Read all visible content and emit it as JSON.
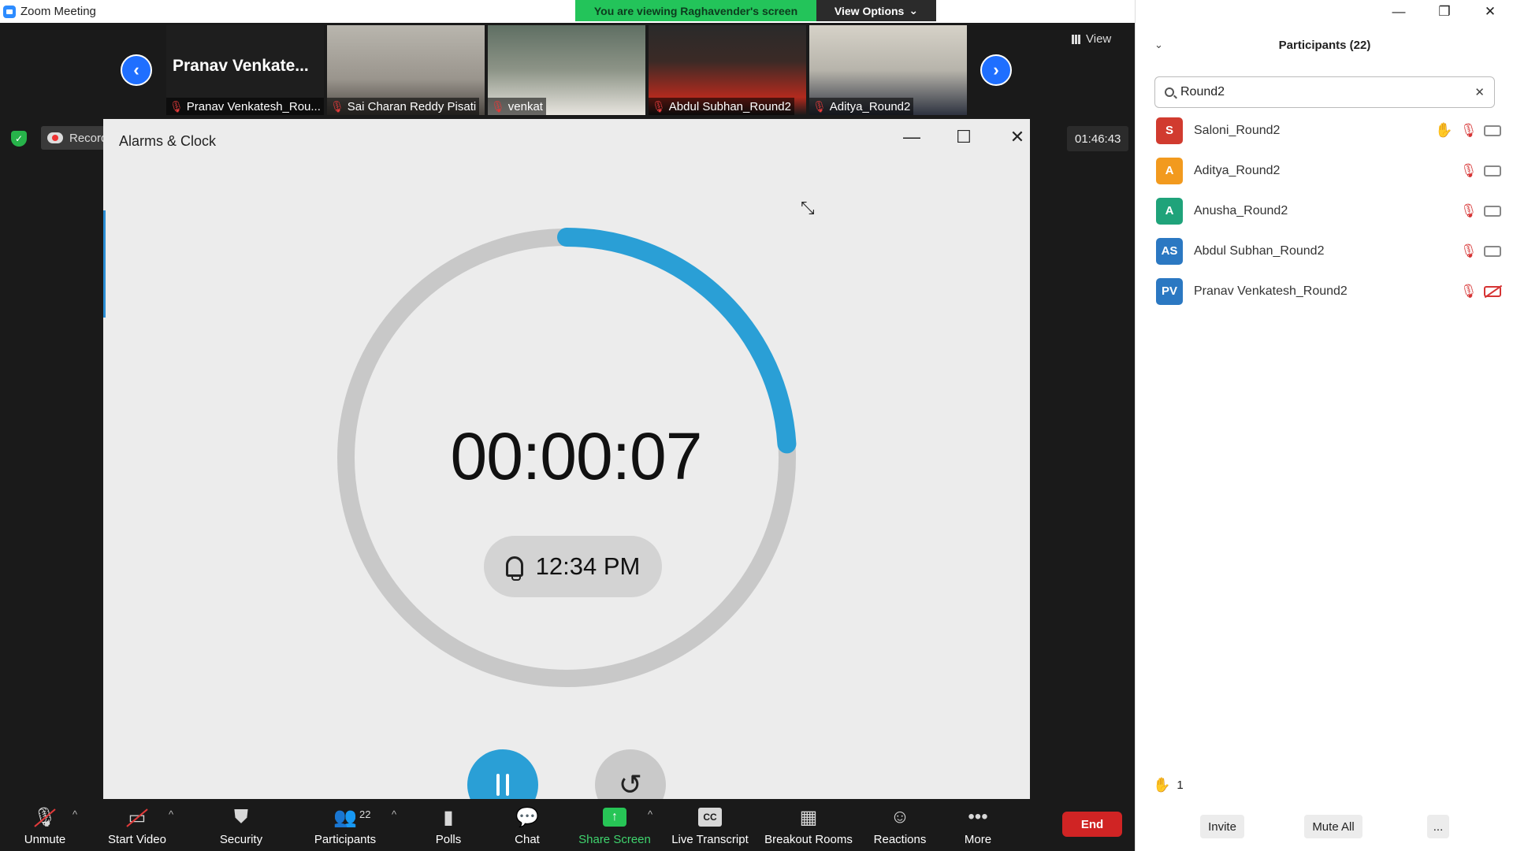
{
  "window": {
    "title": "Zoom Meeting"
  },
  "banner": {
    "viewing": "You are viewing Raghavender's screen",
    "view_options": "View Options"
  },
  "strip": {
    "tiles": [
      {
        "label": "Pranav Venkatesh_Rou...",
        "big_name": "Pranav  Venkate..."
      },
      {
        "label": "Sai Charan Reddy Pisati"
      },
      {
        "label": "venkat"
      },
      {
        "label": "Abdul Subhan_Round2"
      },
      {
        "label": "Aditya_Round2"
      }
    ]
  },
  "view_label": "View",
  "recording_label": "Recording...",
  "meeting_timer": "01:46:43",
  "shared_window": {
    "title": "Alarms & Clock",
    "stopwatch": "00:00:07",
    "alarm_time": "12:34 PM",
    "progress_fraction": 0.24,
    "accent_color": "#2a9fd6",
    "track_color": "#c8c8c8"
  },
  "toolbar": {
    "unmute": "Unmute",
    "start_video": "Start Video",
    "security": "Security",
    "participants": "Participants",
    "participants_count": "22",
    "polls": "Polls",
    "chat": "Chat",
    "share_screen": "Share Screen",
    "live_transcript": "Live Transcript",
    "cc": "CC",
    "breakout_rooms": "Breakout Rooms",
    "reactions": "Reactions",
    "more": "More",
    "end": "End"
  },
  "panel": {
    "title": "Participants (22)",
    "search_value": "Round2",
    "participants": [
      {
        "initials": "S",
        "name": "Saloni_Round2",
        "color": "#d13b2f",
        "hand_raised": true,
        "video_off": false
      },
      {
        "initials": "A",
        "name": "Aditya_Round2",
        "color": "#f29a1e",
        "hand_raised": false,
        "video_off": false
      },
      {
        "initials": "A",
        "name": "Anusha_Round2",
        "color": "#1fa37a",
        "hand_raised": false,
        "video_off": false
      },
      {
        "initials": "AS",
        "name": "Abdul Subhan_Round2",
        "color": "#2b78c2",
        "hand_raised": false,
        "video_off": false
      },
      {
        "initials": "PV",
        "name": "Pranav Venkatesh_Round2",
        "color": "#2b78c2",
        "hand_raised": false,
        "video_off": true
      }
    ],
    "raised_hands_count": "1",
    "invite": "Invite",
    "mute_all": "Mute All",
    "more": "..."
  }
}
